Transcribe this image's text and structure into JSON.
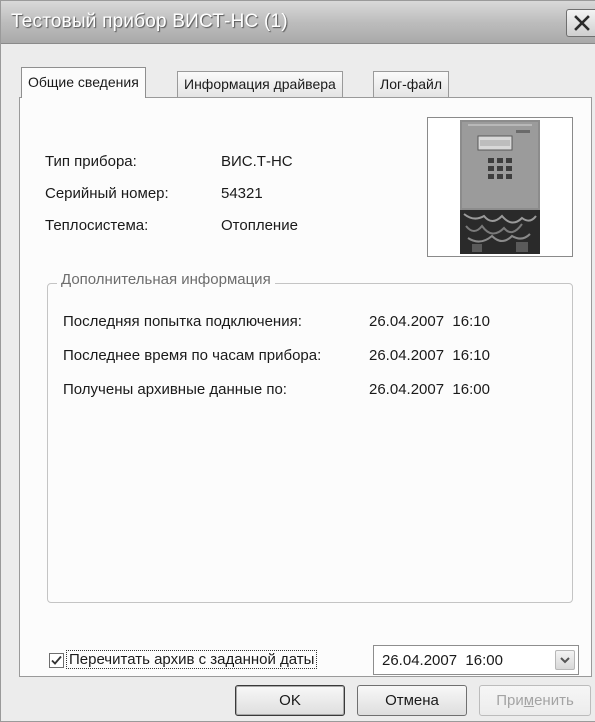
{
  "window": {
    "title": "Тестовый прибор ВИСТ-НС (1)"
  },
  "tabs": [
    {
      "label": "Общие сведения",
      "active": true
    },
    {
      "label": "Информация драйвера",
      "active": false
    },
    {
      "label": "Лог-файл",
      "active": false
    }
  ],
  "device": {
    "type_label": "Тип прибора:",
    "type_value": "ВИС.Т-НС",
    "serial_label": "Серийный номер:",
    "serial_value": "54321",
    "system_label": "Теплосистема:",
    "system_value": "Отопление"
  },
  "additional": {
    "group_title": "Дополнительная информация",
    "rows": [
      {
        "label": "Последняя попытка подключения:",
        "value": "26.04.2007  16:10"
      },
      {
        "label": "Последнее время по часам прибора:",
        "value": "26.04.2007  16:10"
      },
      {
        "label": "Получены архивные данные по:",
        "value": "26.04.2007  16:00"
      }
    ]
  },
  "reread": {
    "label": "Перечитать архив с заданной даты",
    "checked": true,
    "date_value": "26.04.2007  16:00"
  },
  "buttons": {
    "ok": "OK",
    "cancel": "Отмена",
    "apply_pre": "При",
    "apply_u": "м",
    "apply_post": "енить"
  },
  "icons": {
    "close": "close-icon",
    "checkmark": "checkmark-icon",
    "dropdown": "chevron-down-icon"
  }
}
